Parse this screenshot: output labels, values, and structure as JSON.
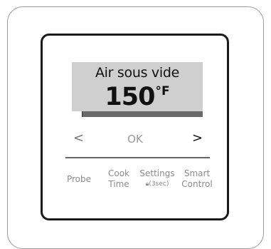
{
  "display": {
    "mode": "Air sous vide",
    "temperature": "150",
    "unit": "°F",
    "progress_fraction": 0.08
  },
  "navigation": {
    "left": "<",
    "ok": "OK",
    "right": ">"
  },
  "buttons": [
    {
      "line1": "Probe",
      "line2": ""
    },
    {
      "line1": "Cook",
      "line2": "Time"
    },
    {
      "line1": "Settings",
      "lock_icon": "lock-icon",
      "line2": "(3sec)"
    },
    {
      "line1": "Smart",
      "line2": "Control"
    }
  ]
}
